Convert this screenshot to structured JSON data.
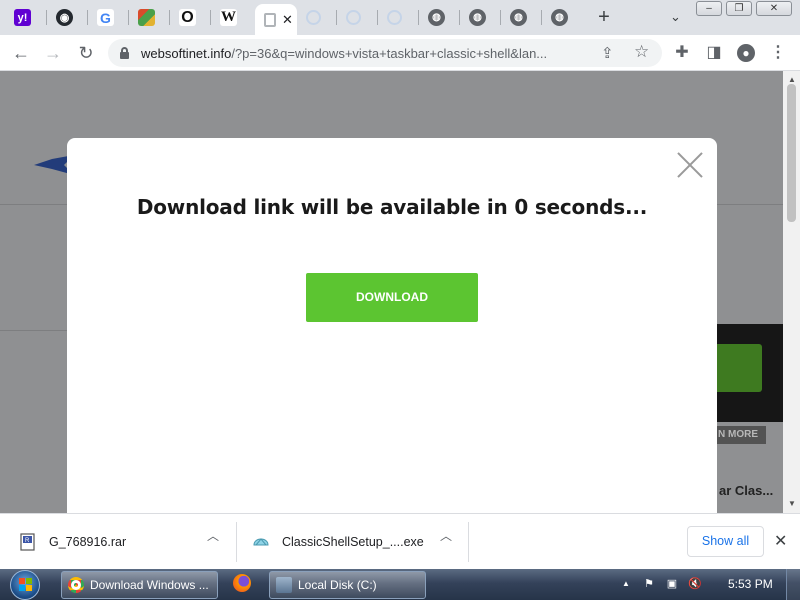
{
  "browser": {
    "tabs": [
      {
        "name": "yahoo",
        "glyph": "y!",
        "bg": "#6001d2"
      },
      {
        "name": "github",
        "glyph": "●",
        "bg": "#24292f"
      },
      {
        "name": "google",
        "glyph": "G",
        "bg": "#ffffff"
      },
      {
        "name": "app",
        "glyph": "▦",
        "bg": "#8a6d2b"
      },
      {
        "name": "site-o",
        "glyph": "O",
        "bg": "#ffffff"
      },
      {
        "name": "wikipedia",
        "glyph": "W",
        "bg": "#ffffff"
      },
      {
        "name": "active-loading",
        "glyph": "",
        "bg": "#ffffff"
      },
      {
        "name": "loading-1",
        "glyph": "",
        "bg": "#dee1e6"
      },
      {
        "name": "loading-2",
        "glyph": "",
        "bg": "#dee1e6"
      },
      {
        "name": "loading-3",
        "glyph": "",
        "bg": "#dee1e6"
      },
      {
        "name": "globe-1",
        "glyph": "",
        "bg": "#5f6368"
      },
      {
        "name": "globe-2",
        "glyph": "",
        "bg": "#5f6368"
      },
      {
        "name": "globe-3",
        "glyph": "",
        "bg": "#5f6368"
      },
      {
        "name": "globe-4",
        "glyph": "",
        "bg": "#5f6368"
      }
    ],
    "address": {
      "host": "websoftinet.info",
      "path": "/?p=36&q=windows+vista+taskbar+classic+shell&lan..."
    }
  },
  "page": {
    "background_card_button": "N MORE",
    "background_post_title": "ar Clas..."
  },
  "modal": {
    "title": "Download link will be available in 0 seconds...",
    "button_label": "DOWNLOAD"
  },
  "downloads": {
    "items": [
      {
        "name": "G_768916.rar"
      },
      {
        "name": "ClassicShellSetup_....exe"
      }
    ],
    "show_all_label": "Show all"
  },
  "taskbar": {
    "tasks": [
      {
        "label": "Download Windows ..."
      },
      {
        "label": "Local Disk (C:)"
      }
    ],
    "clock": "5:53 PM"
  },
  "colors": {
    "download_button": "#5cc531",
    "overlay": "#8f9092",
    "link_blue": "#1a73e8"
  }
}
